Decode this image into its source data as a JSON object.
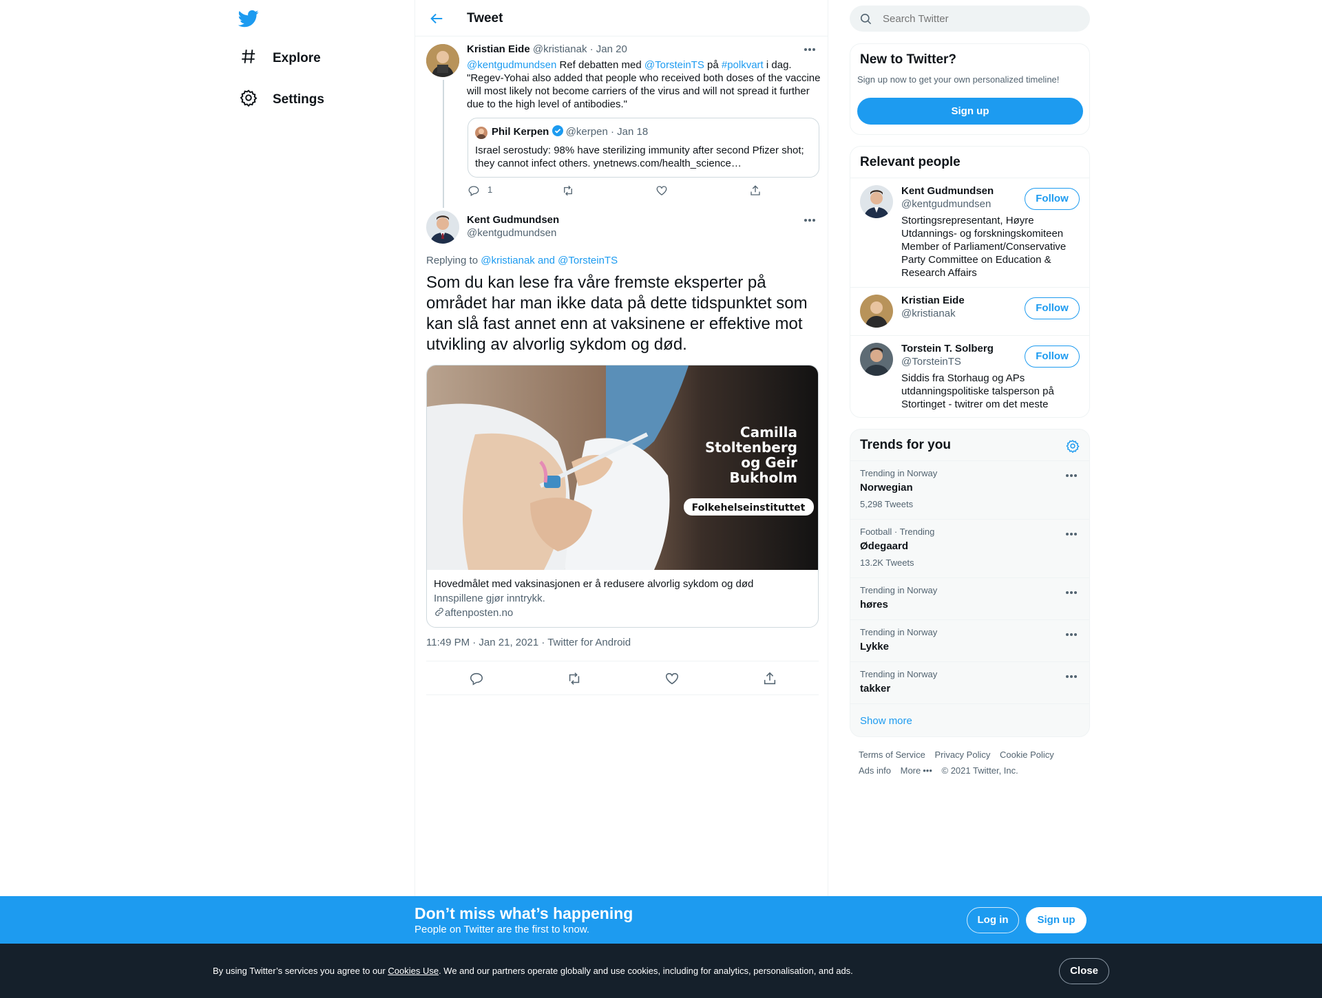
{
  "nav": {
    "logo_icon": "twitter-bird-icon",
    "items": [
      {
        "label": "Explore",
        "icon": "hashtag-icon"
      },
      {
        "label": "Settings",
        "icon": "gear-icon"
      }
    ]
  },
  "header": {
    "title": "Tweet",
    "back_icon": "arrow-left-icon"
  },
  "parent_tweet": {
    "name": "Kristian Eide",
    "handle": "@kristianak",
    "date": "· Jan 20",
    "mention1": "@kentgudmundsen",
    "text1": " Ref debatten med ",
    "mention2": "@TorsteinTS",
    "text2": " på ",
    "hashtag": "#polkvart",
    "text3": " i dag. \"Regev-Yohai also added that people who received both doses of the vaccine will most likely not become carriers of the virus and will not spread it further due to the high level of antibodies.\"",
    "reply_count": "1",
    "quote": {
      "name": "Phil Kerpen",
      "handle": "@kerpen",
      "date": "· Jan 18",
      "text": "Israel serostudy: 98% have sterilizing immunity after second Pfizer shot; they cannot infect others. ynetnews.com/health_science…"
    }
  },
  "main_tweet": {
    "name": "Kent Gudmundsen",
    "handle": "@kentgudmundsen",
    "replying_prefix": "Replying to ",
    "replying_to": "@kristianak and @TorsteinTS",
    "text": "Som du kan lese fra våre fremste eksperter på området har man ikke data på dette tidspunktet som kan slå fast annet enn at vaksinene er effektive mot utvikling av alvorlig sykdom og død.",
    "card": {
      "overlay_name": [
        "Camilla",
        "Stoltenberg",
        "og Geir",
        "Bukholm"
      ],
      "overlay_org": "Folkehelseinstituttet",
      "title": "Hovedmålet med vaksinasjonen er å redusere alvorlig sykdom og død",
      "description": "Innspillene gjør inntrykk.",
      "domain": "aftenposten.no"
    },
    "timestamp": "11:49 PM · Jan 21, 2021 · Twitter for Android"
  },
  "search": {
    "placeholder": "Search Twitter"
  },
  "new_to_twitter": {
    "title": "New to Twitter?",
    "subtitle": "Sign up now to get your own personalized timeline!",
    "button": "Sign up"
  },
  "relevant_people": {
    "title": "Relevant people",
    "follow_label": "Follow",
    "people": [
      {
        "name": "Kent Gudmundsen",
        "handle": "@kentgudmundsen",
        "bio": "Stortingsrepresentant, Høyre Utdannings- og forskningskomiteen Member of Parliament/Conservative Party Committee on Education & Research Affairs"
      },
      {
        "name": "Kristian Eide",
        "handle": "@kristianak",
        "bio": ""
      },
      {
        "name": "Torstein T. Solberg",
        "handle": "@TorsteinTS",
        "bio": "Siddis fra Storhaug og APs utdanningspolitiske talsperson på Stortinget - twitrer om det meste"
      }
    ]
  },
  "trends": {
    "title": "Trends for you",
    "items": [
      {
        "meta": "Trending in Norway",
        "name": "Norwegian",
        "count": "5,298 Tweets"
      },
      {
        "meta": "Football · Trending",
        "name": "Ødegaard",
        "count": "13.2K Tweets"
      },
      {
        "meta": "Trending in Norway",
        "name": "høres",
        "count": ""
      },
      {
        "meta": "Trending in Norway",
        "name": "Lykke",
        "count": ""
      },
      {
        "meta": "Trending in Norway",
        "name": "takker",
        "count": ""
      }
    ],
    "show_more": "Show more"
  },
  "footer": {
    "links_row1": [
      "Terms of Service",
      "Privacy Policy",
      "Cookie Policy"
    ],
    "links_row2": [
      "Ads info",
      "More"
    ],
    "copyright": "© 2021 Twitter, Inc."
  },
  "banner": {
    "heading": "Don’t miss what’s happening",
    "subheading": "People on Twitter are the first to know.",
    "login": "Log in",
    "signup": "Sign up"
  },
  "cookie": {
    "prefix": "By using Twitter’s services you agree to our ",
    "link": "Cookies Use",
    "suffix": ". We and our partners operate globally and use cookies, including for analytics, personalisation, and ads.",
    "close": "Close"
  },
  "colors": {
    "accent": "#1d9bf0",
    "text": "#0f1419",
    "muted": "#536471",
    "cookie_bg": "#15202b"
  }
}
